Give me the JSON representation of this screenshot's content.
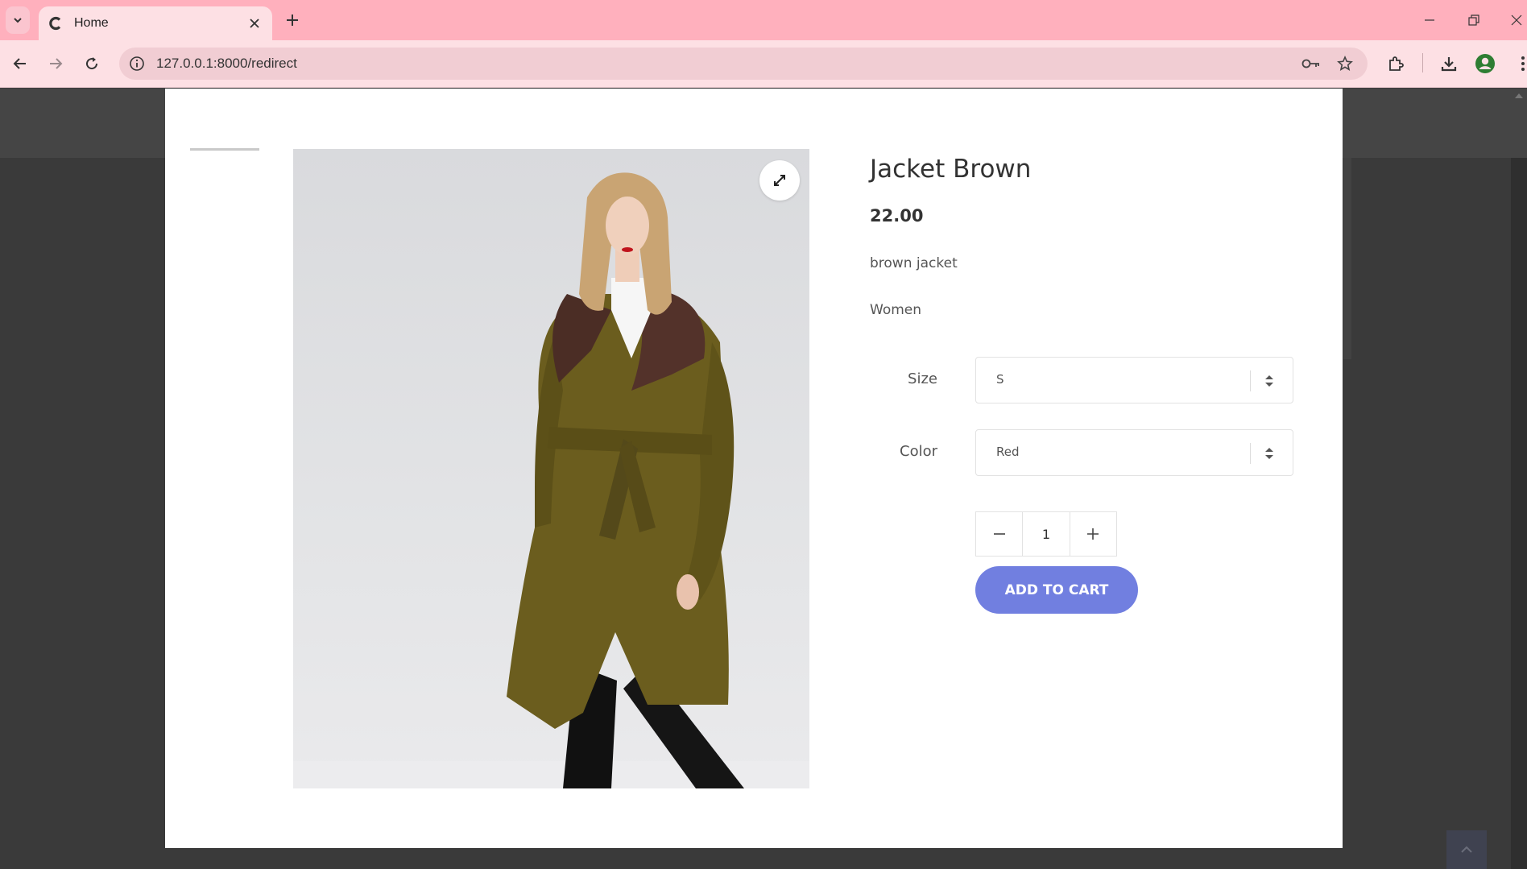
{
  "browser": {
    "tab_title": "Home",
    "url": "127.0.0.1:8000/redirect"
  },
  "product": {
    "title": "Jacket Brown",
    "price": "22.00",
    "description": "brown jacket",
    "category": "Women",
    "size_label": "Size",
    "size_value": "S",
    "color_label": "Color",
    "color_value": "Red",
    "quantity": "1",
    "add_to_cart_label": "ADD TO CART"
  },
  "colors": {
    "tabbar": "#ffb0bd",
    "toolbar": "#fde0e4",
    "accent": "#717fe0",
    "overlay": "#3a3a3a"
  },
  "icons": {
    "expand": "expand-arrows-icon",
    "select": "updown-caret-icon",
    "minus": "minus-icon",
    "plus": "plus-icon"
  }
}
